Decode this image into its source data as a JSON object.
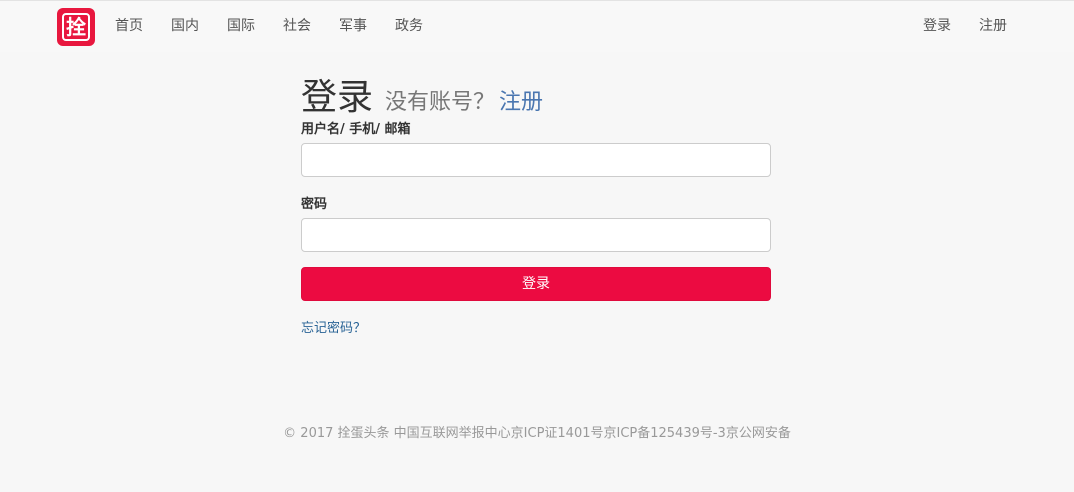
{
  "header": {
    "logo_glyph": "拴",
    "nav": [
      "首页",
      "国内",
      "国际",
      "社会",
      "军事",
      "政务"
    ],
    "right_nav": [
      "登录",
      "注册"
    ]
  },
  "login": {
    "title": "登录",
    "subtitle": "没有账号？",
    "register_link": "注册",
    "username_label": "用户名/ 手机/ 邮箱",
    "username_value": "",
    "password_label": "密码",
    "password_value": "",
    "submit_label": "登录",
    "forgot_link": "忘记密码？"
  },
  "footer": {
    "text": "© 2017 拴蛋头条 中国互联网举报中心京ICP证1401号京ICP备125439号-3京公网安备"
  },
  "colors": {
    "brand": "#e8173e",
    "button": "#ec0b41",
    "link": "#2a6496"
  }
}
